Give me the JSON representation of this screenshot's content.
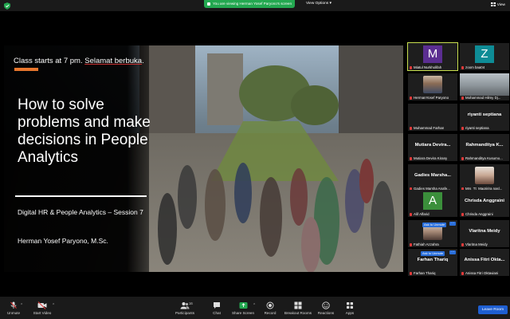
{
  "topbar": {
    "share_banner": "You are viewing Herman Yosef Paryono's screen",
    "view_options": "View Options",
    "view_label": "View"
  },
  "slide": {
    "class_note_prefix": "Class starts at 7 pm.",
    "class_note_underlined": "Selamat berbuka",
    "class_note_suffix": ".",
    "title": "How to solve problems and make decisions in People Analytics",
    "subtitle": "Digital HR & People Analytics – Session 7",
    "presenter": "Herman Yosef Paryono, M.Sc.",
    "accent_color": "#e8772e"
  },
  "gallery": {
    "tiles": [
      {
        "name": "Miatul Nurkholifah",
        "letter": "M",
        "letter_bg": "#5b2e91",
        "kind": "letter",
        "active": true
      },
      {
        "name": "zoom baa04",
        "letter": "Z",
        "letter_bg": "#0e8c96",
        "kind": "letter",
        "active": false
      },
      {
        "name": "HermanYosef Paryono",
        "kind": "photo",
        "active": false
      },
      {
        "name": "Mohammad Hilmy Dj...",
        "kind": "photo",
        "active": false
      },
      {
        "name": "Muhammad Farhan",
        "kind": "blank",
        "active": false
      },
      {
        "name": "riyanti septiana",
        "big_name": "riyanti septiana",
        "kind": "bigname",
        "active": false
      },
      {
        "name": "Mutiara Devira Kirany",
        "big_name": "Mutiara Devira...",
        "kind": "bigname",
        "active": false
      },
      {
        "name": "Rahmanditya Kusumo...",
        "big_name": "Rahmanditya K...",
        "kind": "bigname",
        "active": false
      },
      {
        "name": "Gadies Marsha Anafe...",
        "big_name": "Gadies Marsha...",
        "kind": "bigname",
        "active": false
      },
      {
        "name": "Mrs_Tt_Magririra nasl...",
        "kind": "photo",
        "active": false
      },
      {
        "name": "Alif Alfarid",
        "letter": "A",
        "letter_bg": "#3b8f3b",
        "kind": "letter",
        "active": false
      },
      {
        "name": "Chrisda Anggraini",
        "big_name": "Chrisda Anggraini",
        "kind": "bigname",
        "active": false
      },
      {
        "name": "Fathiah Azzahra",
        "unmute": "Ask to Unmute",
        "kind": "photo",
        "active": false
      },
      {
        "name": "Vlaritna Meidy",
        "big_name": "Vlaritna Meidy",
        "kind": "bigname",
        "active": false
      },
      {
        "name": "Farhan Thariq",
        "big_name": "Farhan Thariq",
        "unmute": "Ask to Unmute",
        "kind": "bigname",
        "active": false
      },
      {
        "name": "Anissa Fitri Oktaviani",
        "big_name": "Anissa Fitri Okta...",
        "kind": "bigname",
        "active": false
      }
    ]
  },
  "toolbar": {
    "unmute": "Unmute",
    "start_video": "Start Video",
    "participants": "Participants",
    "participants_count": "16",
    "chat": "Chat",
    "share_screen": "Share Screen",
    "record": "Record",
    "breakout_rooms": "Breakout Rooms",
    "reactions": "Reactions",
    "apps": "Apps",
    "leave": "Leave Room",
    "share_color": "#23a850",
    "leave_color": "#1f5fd1"
  }
}
